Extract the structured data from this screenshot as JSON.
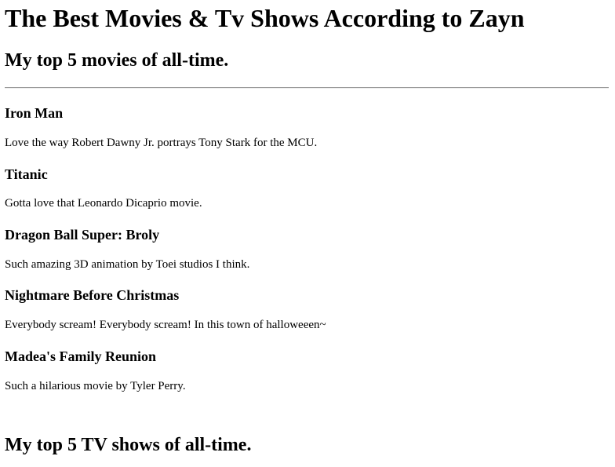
{
  "page": {
    "title": "The Best Movies & Tv Shows According to Zayn"
  },
  "movies": {
    "heading": "My top 5 movies of all-time.",
    "items": [
      {
        "title": "Iron Man",
        "description": "Love the way Robert Dawny Jr. portrays Tony Stark for the MCU."
      },
      {
        "title": "Titanic",
        "description": "Gotta love that Leonardo Dicaprio movie."
      },
      {
        "title": "Dragon Ball Super: Broly",
        "description": "Such amazing 3D animation by Toei studios I think."
      },
      {
        "title": "Nightmare Before Christmas",
        "description": "Everybody scream! Everybody scream! In this town of halloweeen~"
      },
      {
        "title": "Madea's Family Reunion",
        "description": "Such a hilarious movie by Tyler Perry."
      }
    ]
  },
  "tv": {
    "heading": "My top 5 TV shows of all-time."
  }
}
